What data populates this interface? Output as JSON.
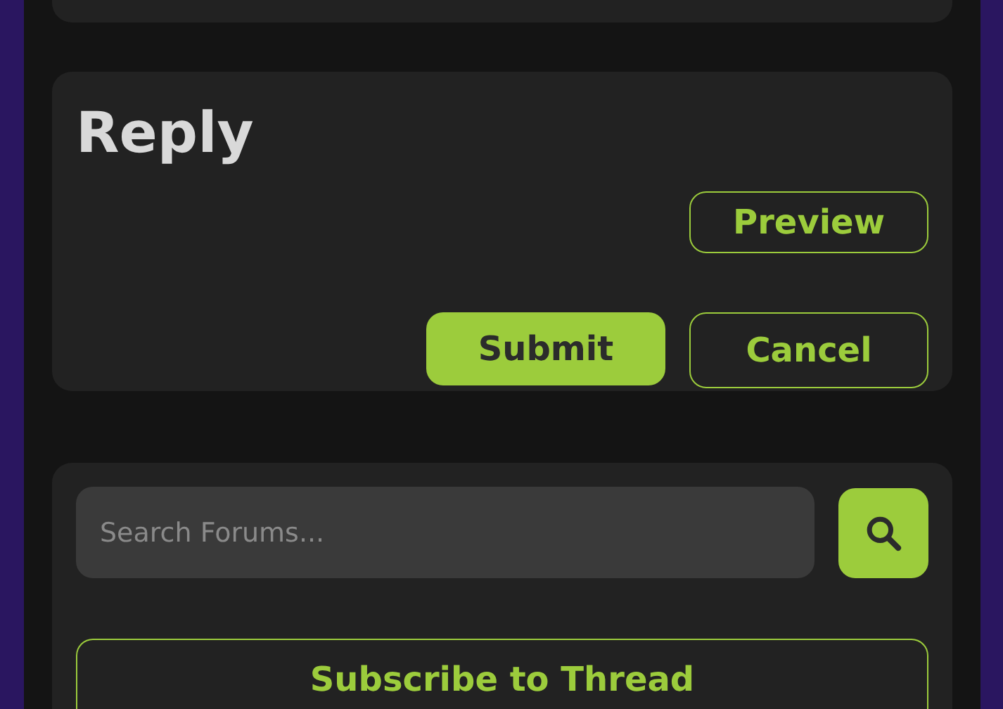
{
  "reply": {
    "title": "Reply",
    "preview_button": "Preview",
    "submit_button": "Submit",
    "cancel_button": "Cancel"
  },
  "search": {
    "placeholder": "Search Forums..."
  },
  "subscribe_button": "Subscribe to Thread"
}
